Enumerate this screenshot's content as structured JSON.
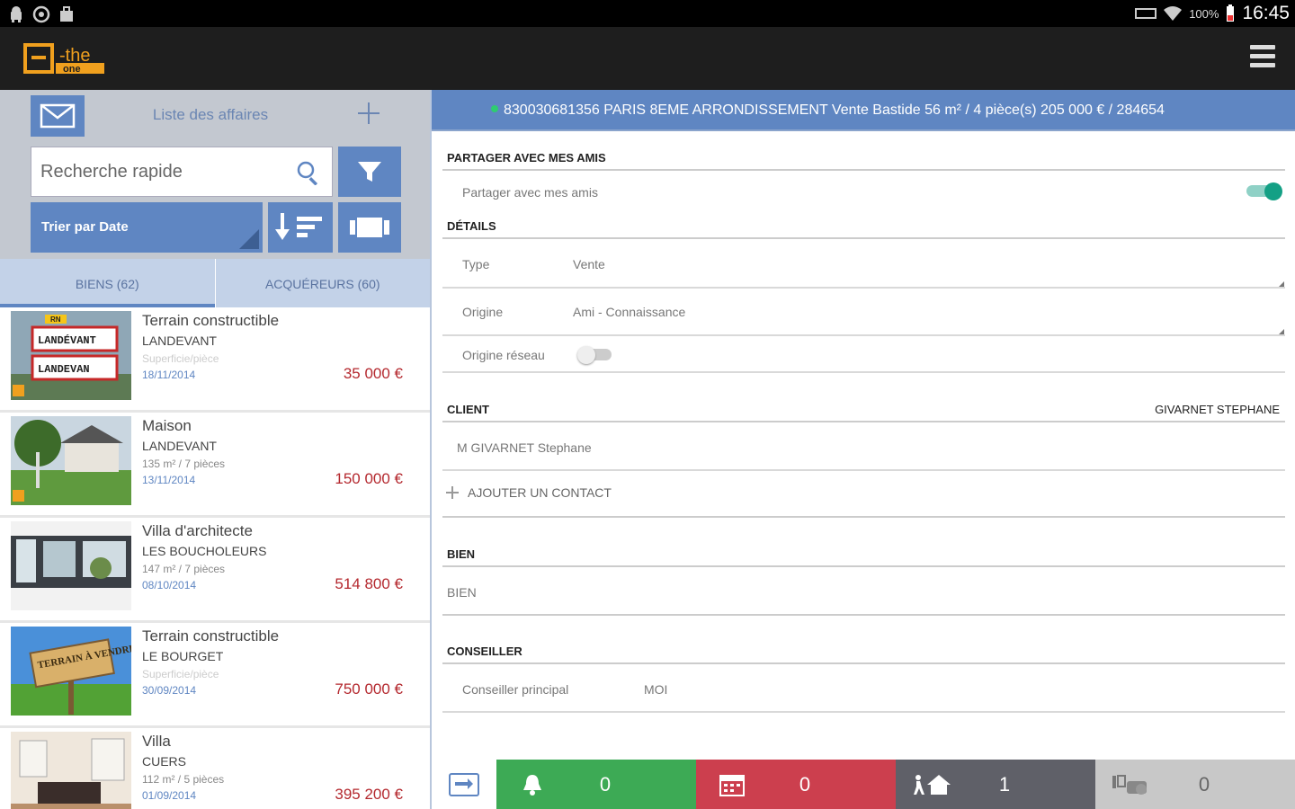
{
  "status_bar": {
    "battery": "100%",
    "time": "16:45"
  },
  "app": {
    "logo_text": "e-the one"
  },
  "sidebar": {
    "title": "Liste des affaires",
    "search_placeholder": "Recherche rapide",
    "sort_label": "Trier par Date",
    "tabs": [
      {
        "label": "BIENS (62)",
        "active": true
      },
      {
        "label": "ACQUÉREURS (60)",
        "active": false
      }
    ],
    "items": [
      {
        "title": "Terrain constructible",
        "location": "LANDEVANT",
        "surface": "Superficie/pièce",
        "date": "18/11/2014",
        "price": "35 000 €",
        "surface_empty": true
      },
      {
        "title": "Maison",
        "location": "LANDEVANT",
        "surface": "135 m² / 7 pièces",
        "date": "13/11/2014",
        "price": "150 000 €",
        "surface_empty": false
      },
      {
        "title": "Villa d'architecte",
        "location": "LES BOUCHOLEURS",
        "surface": "147 m² / 7 pièces",
        "date": "08/10/2014",
        "price": "514 800 €",
        "surface_empty": false
      },
      {
        "title": "Terrain constructible",
        "location": "LE BOURGET",
        "surface": "Superficie/pièce",
        "date": "30/09/2014",
        "price": "750 000 €",
        "surface_empty": true
      },
      {
        "title": "Villa",
        "location": "CUERS",
        "surface": "112 m² / 5 pièces",
        "date": "01/09/2014",
        "price": "395 200 €",
        "surface_empty": false
      }
    ],
    "thumb_texts": {
      "sign1": "LANDÉVANT",
      "sign2": "LANDEVAN",
      "sign_small": "RN",
      "terrain_sign": "TERRAIN À VENDRE"
    }
  },
  "detail": {
    "header": "830030681356 PARIS 8EME ARRONDISSEMENT Vente Bastide 56 m² / 4 pièce(s) 205 000 € / 284654",
    "share": {
      "section": "PARTAGER AVEC MES AMIS",
      "label": "Partager avec mes amis",
      "on": true
    },
    "details": {
      "section": "DÉTAILS",
      "type_label": "Type",
      "type_value": "Vente",
      "origine_label": "Origine",
      "origine_value": "Ami - Connaissance",
      "origine_reseau_label": "Origine réseau",
      "origine_reseau_on": false
    },
    "client": {
      "section": "CLIENT",
      "name_right": "GIVARNET STEPHANE",
      "contact": "M GIVARNET Stephane",
      "add_contact": "AJOUTER UN CONTACT"
    },
    "bien": {
      "section": "BIEN",
      "value": "BIEN"
    },
    "conseiller": {
      "section": "CONSEILLER",
      "label": "Conseiller principal",
      "value": "MOI"
    }
  },
  "bottom_bar": {
    "alerts_count": "0",
    "calendar_count": "0",
    "visits_count": "1",
    "offers_count": "0",
    "colors": {
      "green": "#3daa55",
      "red": "#cc3f4e",
      "grey": "#5f6068",
      "light": "#c8c8c8"
    }
  },
  "colors": {
    "accent": "#5f86c2",
    "price": "#b4282e",
    "toggle_on": "#14a085"
  }
}
